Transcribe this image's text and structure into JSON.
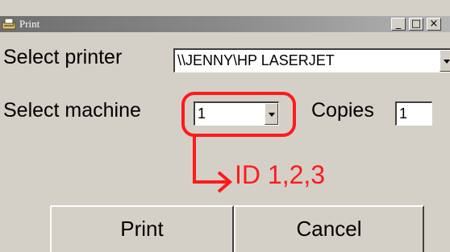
{
  "window": {
    "title": "Print",
    "minimize_glyph": "_",
    "maximize_glyph": "□",
    "close_glyph": "×"
  },
  "printer": {
    "label": "Select printer",
    "value": "\\\\JENNY\\HP LASERJET"
  },
  "machine": {
    "label": "Select machine",
    "value": "1"
  },
  "copies": {
    "label": "Copies",
    "value": "1"
  },
  "buttons": {
    "print": "Print",
    "cancel": "Cancel"
  },
  "annotation": {
    "text": "ID 1,2,3",
    "color": "#ff1a1a"
  },
  "icons": {
    "title": "printer-icon",
    "dropdown": "chevron-down-icon",
    "arrow": "annotation-arrow"
  }
}
